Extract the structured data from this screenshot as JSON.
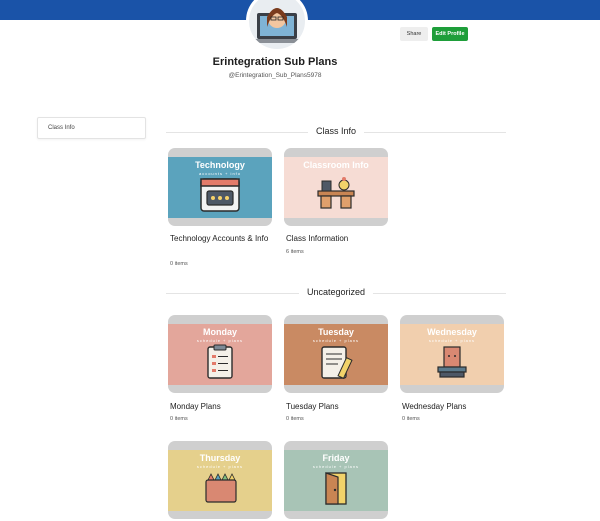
{
  "profile": {
    "name": "Erintegration Sub Plans",
    "handle": "@Erintegration_Sub_Plans5978",
    "share_label": "Share",
    "edit_label": "Edit Profile"
  },
  "sidebar": {
    "items": [
      {
        "label": "Class Info"
      }
    ]
  },
  "sections": [
    {
      "title": "Class Info",
      "cards": [
        {
          "thumb_title": "Technology",
          "thumb_sub": "accounts + info",
          "title": "Technology Accounts & Info",
          "count": "0 items",
          "icon": "computer-icon",
          "color": "#5ba3bd"
        },
        {
          "thumb_title": "Classroom Info",
          "thumb_sub": "",
          "title": "Class Information",
          "count": "6 items",
          "icon": "desk-icon",
          "color": "#f6dcd4"
        }
      ]
    },
    {
      "title": "Uncategorized",
      "cards": [
        {
          "thumb_title": "Monday",
          "thumb_sub": "schedule + plans",
          "title": "Monday Plans",
          "count": "0 items",
          "icon": "clipboard-icon",
          "color": "#e3a69b"
        },
        {
          "thumb_title": "Tuesday",
          "thumb_sub": "schedule + plans",
          "title": "Tuesday Plans",
          "count": "0 items",
          "icon": "document-pencil-icon",
          "color": "#c98a63"
        },
        {
          "thumb_title": "Wednesday",
          "thumb_sub": "schedule + plans",
          "title": "Wednesday Plans",
          "count": "0 items",
          "icon": "books-icon",
          "color": "#f1cfae"
        },
        {
          "thumb_title": "Thursday",
          "thumb_sub": "schedule + plans",
          "title": "",
          "count": "",
          "icon": "crayons-icon",
          "color": "#e5d08c"
        },
        {
          "thumb_title": "Friday",
          "thumb_sub": "schedule + plans",
          "title": "",
          "count": "",
          "icon": "door-icon",
          "color": "#a8c4b6"
        }
      ]
    }
  ]
}
